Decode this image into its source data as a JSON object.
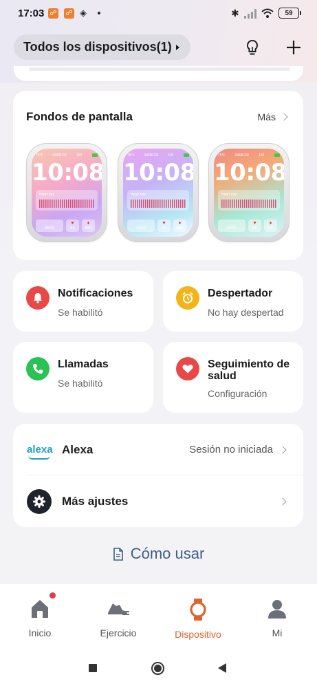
{
  "status_bar": {
    "time": "17:03",
    "battery": "59"
  },
  "header": {
    "device_selector_label": "Todos los dispositivos(1)"
  },
  "wallpapers": {
    "title": "Fondos de pantalla",
    "more_label": "Más",
    "faces": [
      {
        "temp": "75°F",
        "date": "04/08 FR",
        "battery": "100",
        "time": "10:08",
        "heart_label": "Heart rate",
        "tiles": [
          "8500",
          "85",
          "680"
        ]
      },
      {
        "temp": "75°F",
        "date": "04/08 FR",
        "battery": "100",
        "time": "10:08",
        "heart_label": "Heart rate",
        "tiles": [
          "8500",
          "85",
          "680"
        ]
      },
      {
        "temp": "75°F",
        "date": "04/08 FR",
        "battery": "100",
        "time": "10:08",
        "heart_label": "Heart rate",
        "tiles": [
          "8500",
          "85",
          "680"
        ]
      }
    ]
  },
  "features": {
    "notifications": {
      "title": "Notificaciones",
      "subtitle": "Se habilitó",
      "color": "#e94848"
    },
    "alarm": {
      "title": "Despertador",
      "subtitle": "No hay despertad",
      "color": "#f3b418"
    },
    "calls": {
      "title": "Llamadas",
      "subtitle": "Se habilitó",
      "color": "#2bc255"
    },
    "health": {
      "title": "Seguimiento de salud",
      "subtitle": "Configuración",
      "color": "#e94848"
    }
  },
  "settings": {
    "alexa": {
      "logo": "alexa",
      "title": "Alexa",
      "status": "Sesión no iniciada"
    },
    "more": {
      "title": "Más ajustes"
    }
  },
  "how_to": {
    "label": "Cómo usar"
  },
  "bottom_nav": {
    "items": [
      {
        "label": "Inicio",
        "icon": "home-icon"
      },
      {
        "label": "Ejercicio",
        "icon": "shoe-icon"
      },
      {
        "label": "Dispositivo",
        "icon": "watch-icon",
        "active": true
      },
      {
        "label": "Mi",
        "icon": "person-icon"
      }
    ],
    "active_color": "#e0622c"
  }
}
